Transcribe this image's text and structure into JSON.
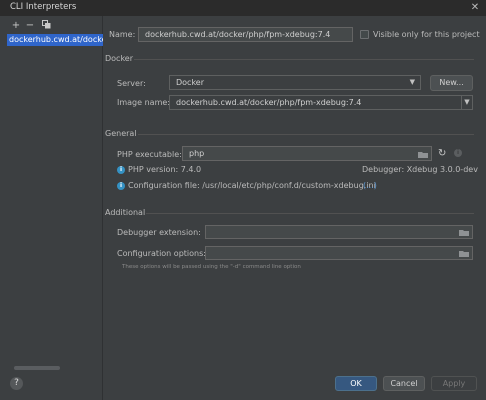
{
  "window": {
    "title": "CLI Interpreters"
  },
  "sidebar": {
    "items": [
      {
        "label": "dockerhub.cwd.at/docker"
      }
    ]
  },
  "name": {
    "label": "Name:",
    "value": "dockerhub.cwd.at/docker/php/fpm-xdebug:7.4"
  },
  "visible_only": {
    "label": "Visible only for this project",
    "checked": false
  },
  "docker": {
    "section": "Docker",
    "server_label": "Server:",
    "server_value": "Docker",
    "new_button": "New...",
    "image_label": "Image name:",
    "image_value": "dockerhub.cwd.at/docker/php/fpm-xdebug:7.4"
  },
  "general": {
    "section": "General",
    "php_exec_label": "PHP executable:",
    "php_exec_value": "php",
    "php_version": "PHP version: 7.4.0",
    "debugger": "Debugger: Xdebug 3.0.0-dev",
    "config_file": "Configuration file: /usr/local/etc/php/conf.d/custom-xdebug.ini",
    "config_more": "(...)"
  },
  "additional": {
    "section": "Additional",
    "debugger_ext_label": "Debugger extension:",
    "debugger_ext_value": "",
    "config_options_label": "Configuration options:",
    "config_options_value": "",
    "hint": "These options will be passed using the \"-d\" command line option"
  },
  "footer": {
    "ok": "OK",
    "cancel": "Cancel",
    "apply": "Apply",
    "help": "?"
  }
}
